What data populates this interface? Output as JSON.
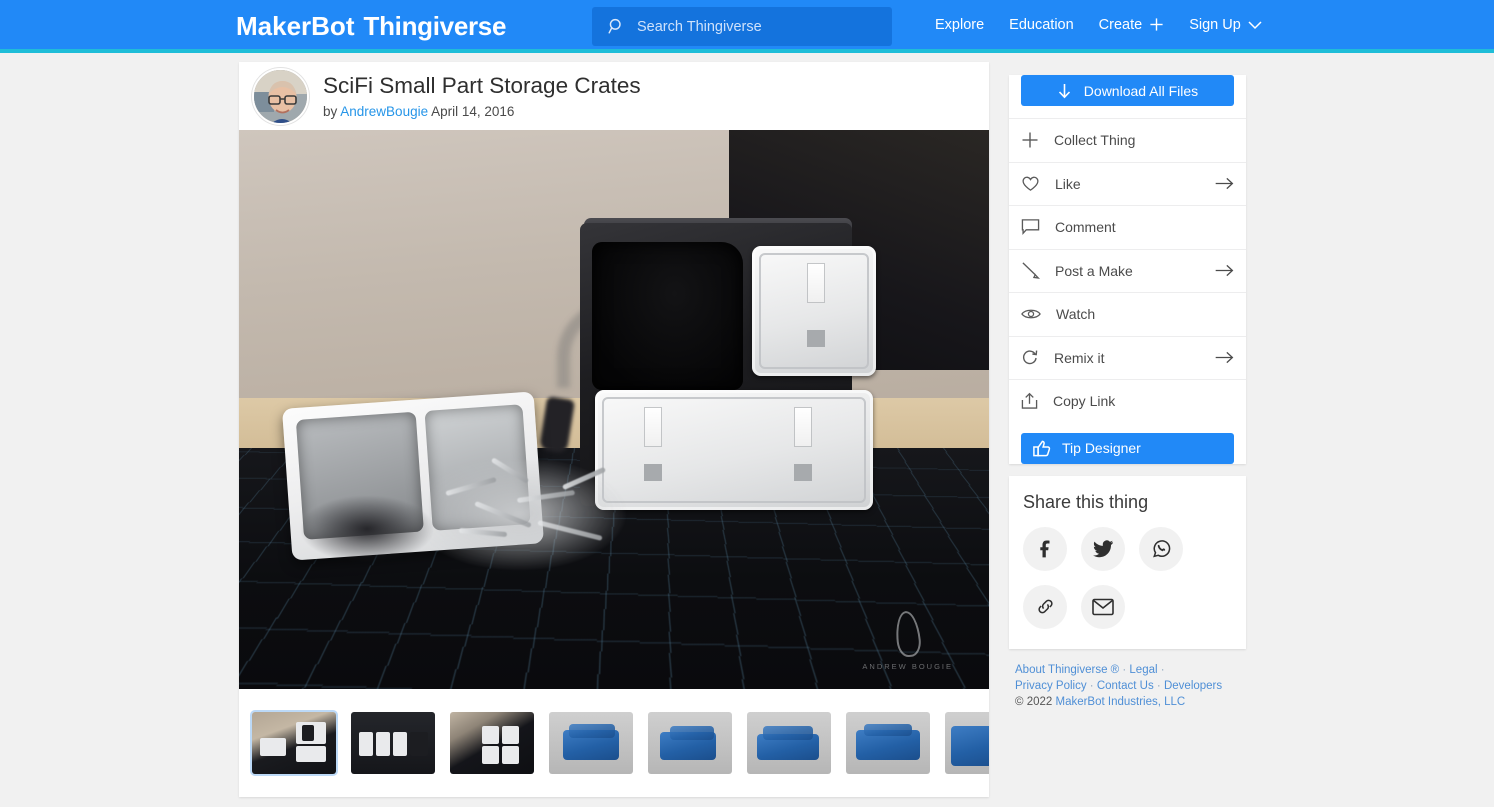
{
  "header": {
    "brand_first": "MakerBot",
    "brand_second": "Thingiverse",
    "search": {
      "icon": "search-icon",
      "placeholder": "Search Thingiverse",
      "value": ""
    },
    "nav": [
      {
        "label": "Explore",
        "icon": null
      },
      {
        "label": "Education",
        "icon": null
      },
      {
        "label": "Create",
        "icon": "plus-icon"
      },
      {
        "label": "Sign Up",
        "icon": "chevron-down-icon"
      }
    ],
    "bg_color": "#2189f7",
    "accent_underline": "#1fbdd8"
  },
  "thing": {
    "title": "SciFi Small Part Storage Crates",
    "by_label": "by",
    "author": "AndrewBougie",
    "date": "April 14, 2016",
    "avatar_name": "author-avatar",
    "watermark": "ANDREW BOUGIE"
  },
  "sidebar": {
    "download_button": {
      "label": "Download All Files",
      "icon": "download-arrow-icon"
    },
    "actions": [
      {
        "label": "Collect Thing",
        "icon": "plus-icon",
        "arrow": false
      },
      {
        "label": "Like",
        "icon": "heart-icon",
        "arrow": true
      },
      {
        "label": "Comment",
        "icon": "comment-icon",
        "arrow": false
      },
      {
        "label": "Post a Make",
        "icon": "pencil-icon",
        "arrow": true
      },
      {
        "label": "Watch",
        "icon": "eye-icon",
        "arrow": false
      },
      {
        "label": "Remix it",
        "icon": "remix-icon",
        "arrow": true
      },
      {
        "label": "Copy Link",
        "icon": "share-upload-icon",
        "arrow": false
      }
    ],
    "tip_button": {
      "label": "Tip Designer",
      "icon": "thumbs-up-icon"
    },
    "share": {
      "title": "Share this thing",
      "buttons": [
        {
          "name": "facebook-icon",
          "label": "f"
        },
        {
          "name": "twitter-icon",
          "label": ""
        },
        {
          "name": "whatsapp-icon",
          "label": ""
        },
        {
          "name": "link-icon",
          "label": ""
        },
        {
          "name": "email-icon",
          "label": ""
        }
      ]
    },
    "footer": {
      "about": "About Thingiverse ®",
      "legal": "Legal",
      "privacy": "Privacy Policy",
      "contact": "Contact Us",
      "developers": "Developers",
      "copyright_symbol": "©",
      "copyright_year": "2022",
      "copyright_owner": "MakerBot Industries, LLC",
      "dot": "·"
    },
    "accent_color": "#2189f7"
  },
  "gallery": {
    "selected_index": 0,
    "thumbnails": [
      {
        "name": "thumbnail-photo-1",
        "kind": "photo1",
        "selected": true
      },
      {
        "name": "thumbnail-photo-2",
        "kind": "photo2",
        "selected": false
      },
      {
        "name": "thumbnail-photo-3",
        "kind": "photo3",
        "selected": false
      },
      {
        "name": "thumbnail-render-1",
        "kind": "render",
        "selected": false
      },
      {
        "name": "thumbnail-render-2",
        "kind": "render",
        "selected": false
      },
      {
        "name": "thumbnail-render-3",
        "kind": "render",
        "selected": false
      },
      {
        "name": "thumbnail-render-4",
        "kind": "render",
        "selected": false
      },
      {
        "name": "thumbnail-render-5",
        "kind": "render",
        "selected": false
      }
    ]
  }
}
